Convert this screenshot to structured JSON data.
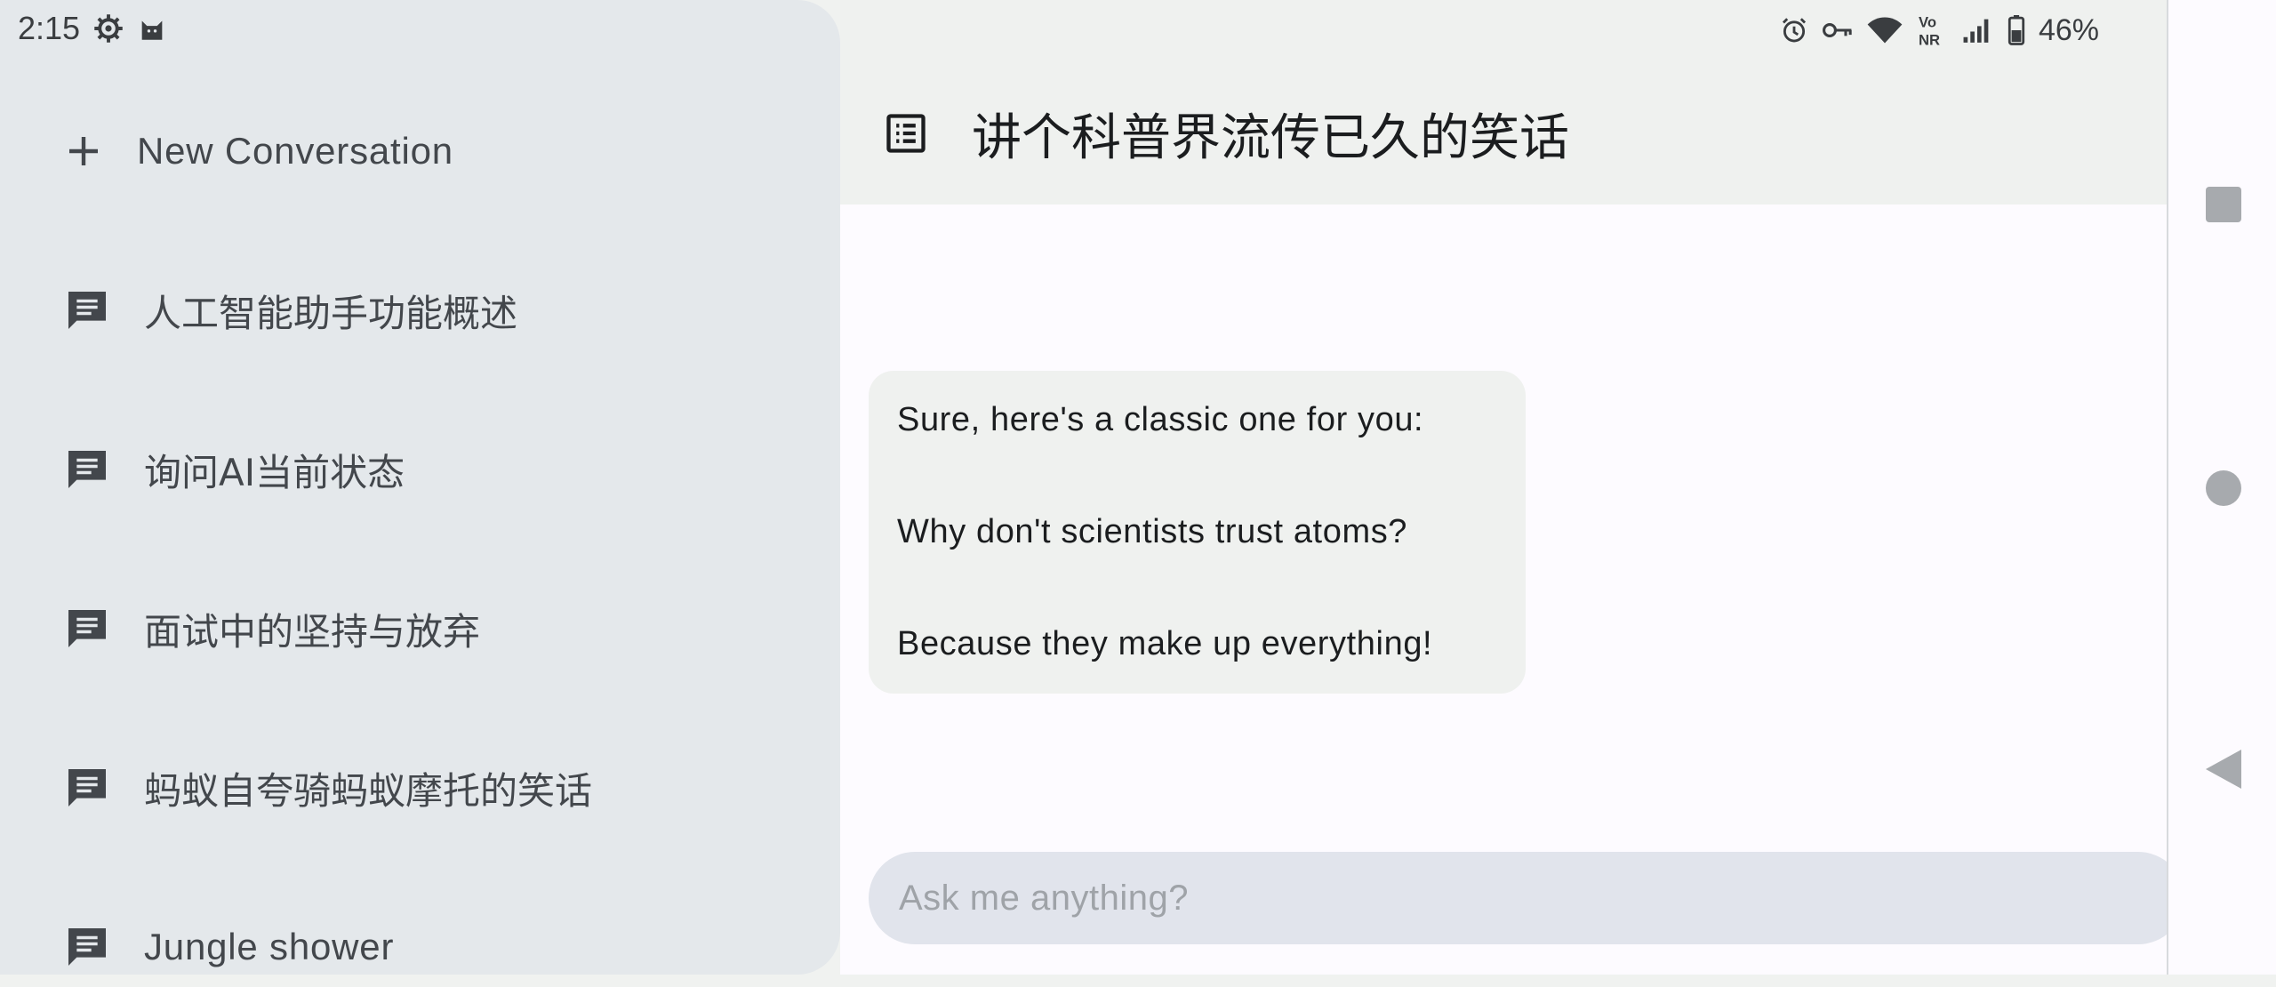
{
  "status_bar": {
    "time": "2:15",
    "battery": "46%"
  },
  "header": {
    "title": "讲个科普界流传已久的笑话"
  },
  "drawer": {
    "new_conversation_label": "New Conversation",
    "conversations": [
      {
        "label": "人工智能助手功能概述"
      },
      {
        "label": "询问AI当前状态"
      },
      {
        "label": "面试中的坚持与放弃"
      },
      {
        "label": "蚂蚁自夸骑蚂蚁摩托的笑话"
      },
      {
        "label": "Jungle shower"
      }
    ]
  },
  "message": {
    "line1": "Sure, here's a classic one for you:",
    "line2": "Why don't scientists trust atoms?",
    "line3": "Because they make up everything!"
  },
  "composer": {
    "placeholder": "Ask me anything?"
  },
  "colors": {
    "drawer_bg": "#e4e8eb",
    "app_bar_bg": "#eff1ef",
    "content_bg": "#fdfbff",
    "composer_bg": "#e1e4ec"
  }
}
